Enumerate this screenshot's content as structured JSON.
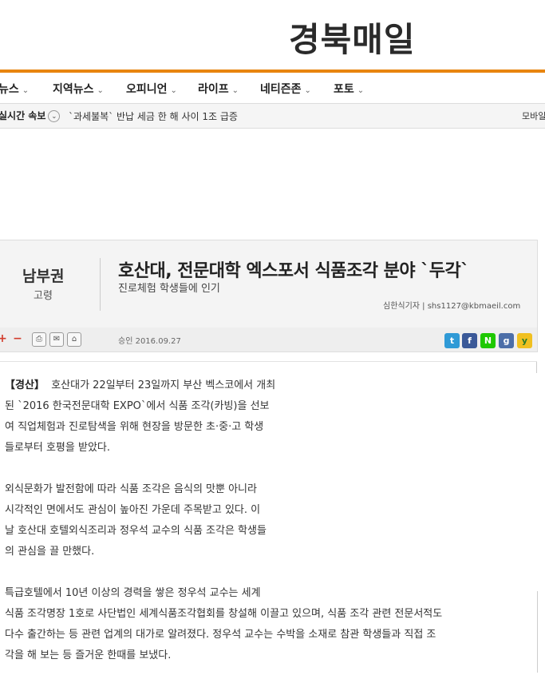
{
  "header": {
    "logo": "경북매일"
  },
  "nav": {
    "items": [
      {
        "label": "뉴스"
      },
      {
        "label": "지역뉴스"
      },
      {
        "label": "오피니언"
      },
      {
        "label": "라이프"
      },
      {
        "label": "네티즌존"
      },
      {
        "label": "포토"
      }
    ],
    "chevron_icon": "chevron-down-icon"
  },
  "ticker": {
    "label": "실시간 속보",
    "text": "`과세불복` 반납 세금 한 해 사이 1조 급증",
    "right": "모바일"
  },
  "article": {
    "section": "남부권",
    "subsection": "고령",
    "headline": "호산대, 전문대학 엑스포서 식품조각 분야 `두각`",
    "subhead": "진로체험 학생들에 인기",
    "byline": "심한식기자  |  shs1127@kbmaeil.com",
    "published": "승인 2016.09.27",
    "toolbar": {
      "plus": "+",
      "minus": "−",
      "icons": [
        "print-icon",
        "email-icon",
        "scrap-icon"
      ]
    },
    "share": {
      "icons": [
        "twitter-icon",
        "facebook-icon",
        "naver-icon",
        "google-icon",
        "yozm-icon"
      ],
      "twitter": "t",
      "facebook": "f",
      "naver": "N",
      "google": "g",
      "yozm": "y"
    },
    "dateline": "【경산】",
    "paragraphs": [
      {
        "lines": [
          "호산대가 22일부터 23일까지 부산 벡스코에서 개최",
          "된 `2016 한국전문대학 EXPO`에서 식품 조각(카빙)을 선보",
          "여 직업체험과 진로탐색을 위해 현장을 방문한 초·중·고 학생",
          "들로부터 호평을 받았다."
        ]
      },
      {
        "lines": [
          "외식문화가 발전함에 따라 식품 조각은 음식의 맛뿐 아니라",
          "시각적인 면에서도 관심이 높아진 가운데 주목받고 있다. 이",
          "날 호산대 호텔외식조리과 정우석 교수의 식품 조각은 학생들",
          "의 관심을 끌 만했다."
        ]
      },
      {
        "lines": [
          "특급호텔에서 10년 이상의 경력을 쌓은 정우석 교수는 세계",
          "식품 조각명장 1호로 사단법인 세계식품조각협회를 창설해 이끌고 있으며, 식품 조각 관련 전문서적도",
          "다수 출간하는 등 관련 업계의 대가로 알려졌다. 정우석 교수는 수박을 소재로 참관 학생들과 직접 조",
          "각을 해 보는 등 즐거운 한때를 보냈다."
        ]
      }
    ]
  },
  "colors": {
    "accent": "#e8850f",
    "twitter": "#2f9ad6",
    "facebook": "#3b5998",
    "naver": "#1ec800",
    "google": "#4c6ea8"
  }
}
